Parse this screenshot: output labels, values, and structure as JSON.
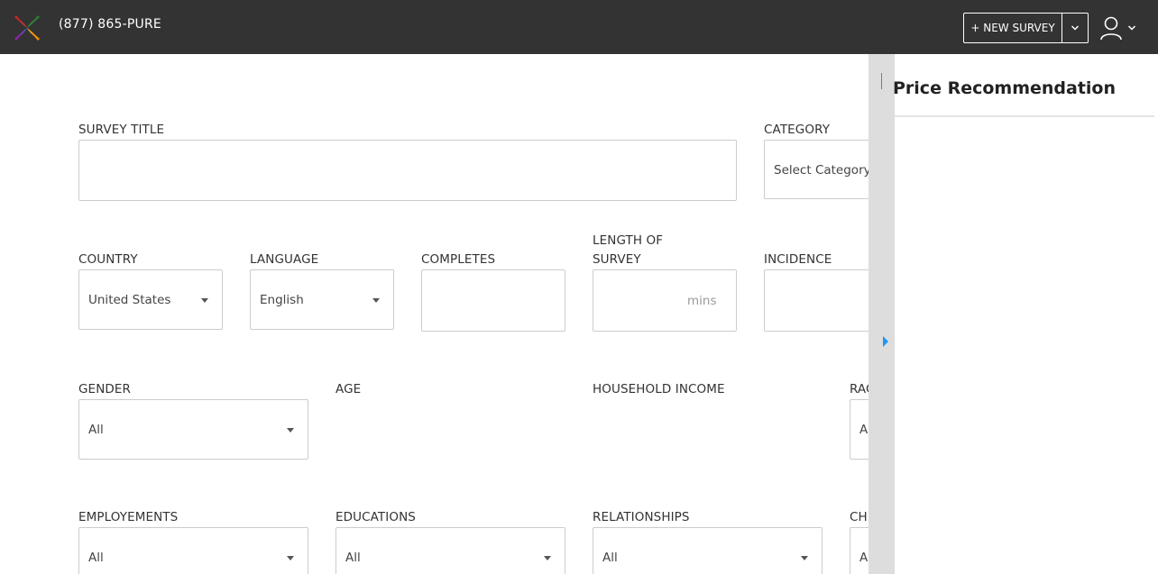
{
  "header": {
    "phone": "(877) 865-PURE",
    "new_survey_label": "+ NEW SURVEY"
  },
  "form": {
    "survey_title": {
      "label": "SURVEY TITLE",
      "value": ""
    },
    "category": {
      "label": "CATEGORY",
      "value": "Select Category"
    },
    "country": {
      "label": "COUNTRY",
      "value": "United States"
    },
    "language": {
      "label": "LANGUAGE",
      "value": "English"
    },
    "completes": {
      "label": "COMPLETES",
      "value": ""
    },
    "length_of_survey": {
      "label_line1": "LENGTH OF",
      "label_line2": "SURVEY",
      "suffix": "mins"
    },
    "incidence": {
      "label": "INCIDENCE",
      "value": ""
    },
    "gender": {
      "label": "GENDER",
      "value": "All"
    },
    "age": {
      "label": "AGE"
    },
    "household_income": {
      "label": "HOUSEHOLD INCOME"
    },
    "race": {
      "label": "RAC",
      "value": "A"
    },
    "employments": {
      "label": "EMPLOYEMENTS",
      "value": "All"
    },
    "educations": {
      "label": "EDUCATIONS",
      "value": "All"
    },
    "relationships": {
      "label": "RELATIONSHIPS",
      "value": "All"
    },
    "children": {
      "label": "CH",
      "value": "A"
    }
  },
  "panel": {
    "title": "Price Recommendation"
  },
  "icons": [
    "logo-icon",
    "chevron-down-icon",
    "user-icon",
    "caret-down-icon",
    "collapse-arrow-icon"
  ],
  "colors": {
    "header_bg": "#333333",
    "accent": "#2196f3",
    "divider_bg": "#dddddd",
    "border": "#cccccc"
  }
}
